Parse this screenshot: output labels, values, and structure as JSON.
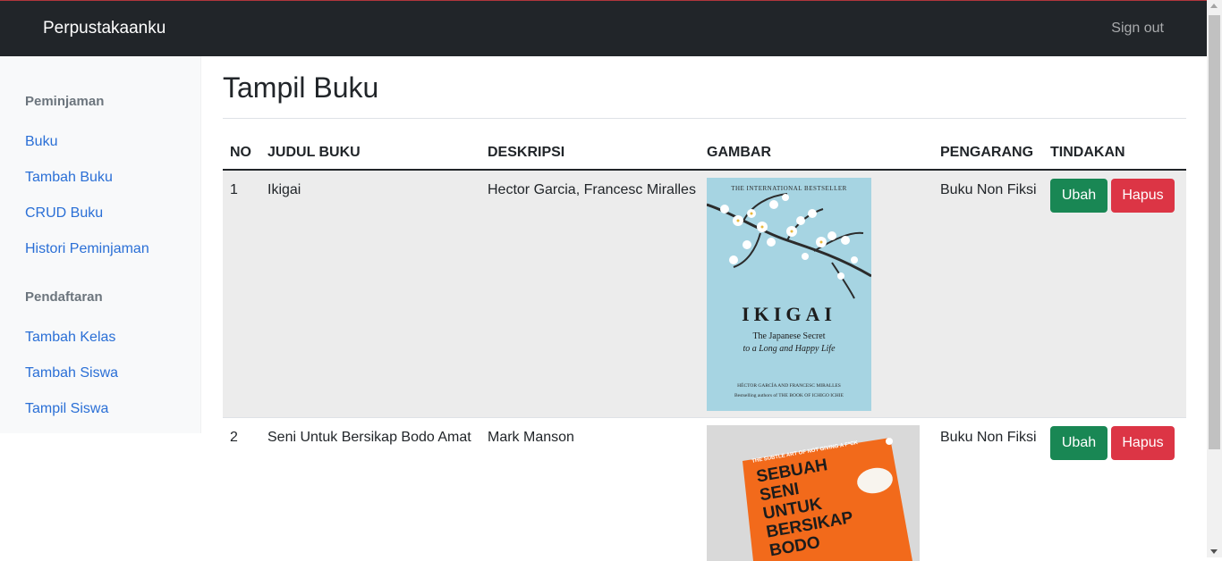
{
  "navbar": {
    "brand": "Perpustakaanku",
    "signout": "Sign out"
  },
  "sidebar": {
    "sections": [
      {
        "heading": "Peminjaman",
        "items": [
          "Buku",
          "Tambah Buku",
          "CRUD Buku",
          "Histori Peminjaman"
        ]
      },
      {
        "heading": "Pendaftaran",
        "items": [
          "Tambah Kelas",
          "Tambah Siswa",
          "Tampil Siswa"
        ]
      }
    ]
  },
  "main": {
    "title": "Tampil Buku"
  },
  "table": {
    "headers": [
      "NO",
      "JUDUL BUKU",
      "DESKRIPSI",
      "GAMBAR",
      "PENGARANG",
      "TINDAKAN"
    ],
    "rows": [
      {
        "no": "1",
        "judul": "Ikigai",
        "deskripsi": "Hector Garcia, Francesc Miralles",
        "pengarang": "Buku Non Fiksi",
        "cover": {
          "top": "THE INTERNATIONAL BESTSELLER",
          "title": "IKIGAI",
          "subtitle1": "The Japanese Secret",
          "subtitle2": "to a Long and Happy Life",
          "authors": "HÉCTOR GARCÍA AND FRANCESC MIRALLES",
          "tagline": "Bestselling authors of THE BOOK OF ICHIGO ICHIE"
        }
      },
      {
        "no": "2",
        "judul": "Seni Untuk Bersikap Bodo Amat",
        "deskripsi": "Mark Manson",
        "pengarang": "Buku Non Fiksi",
        "cover": {
          "top": "THE SUBTLE ART OF NOT GIVING A F*CK",
          "lines": [
            "SEBUAH",
            "SENI",
            "UNTUK",
            "BERSIKAP",
            "BODO"
          ]
        }
      }
    ],
    "edit_label": "Ubah",
    "delete_label": "Hapus"
  },
  "colors": {
    "navbar": "#212529",
    "link": "#2a6fd6",
    "edit": "#198754",
    "delete": "#dc3545",
    "row_stripe": "#ececec"
  }
}
